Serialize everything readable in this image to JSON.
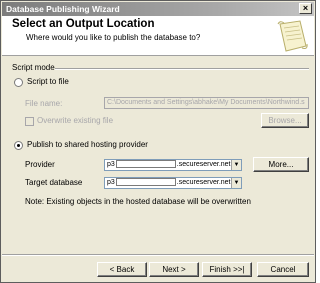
{
  "window": {
    "title": "Database Publishing Wizard",
    "close_glyph": "×"
  },
  "header": {
    "title": "Select an Output Location",
    "subtitle": "Where would you like to publish the database to?"
  },
  "script_mode": {
    "group_label": "Script mode",
    "script_to_file": {
      "label": "Script to file",
      "selected": false,
      "file_name_label": "File name:",
      "file_name_value": "C:\\Documents and Settings\\abhake\\My Documents\\Northwind.s",
      "overwrite_label": "Overwrite existing file",
      "browse_label": "Browse..."
    },
    "publish": {
      "label": "Publish to shared hosting provider",
      "selected": true,
      "provider_label": "Provider",
      "provider_prefix": "p3",
      "provider_suffix": ".secureserver.net",
      "more_label": "More...",
      "target_label": "Target database",
      "target_prefix": "p3",
      "target_suffix": ".secureserver.net",
      "note": "Note: Existing objects in the hosted database will be overwritten"
    }
  },
  "footer": {
    "back_label": "< Back",
    "next_label": "Next >",
    "finish_label": "Finish >>|",
    "cancel_label": "Cancel"
  },
  "icons": [
    "close-icon",
    "scroll-wizard-icon",
    "dropdown-arrow-icon"
  ]
}
